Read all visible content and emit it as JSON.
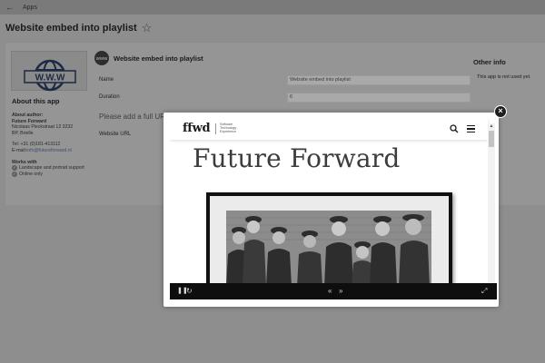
{
  "topbar": {
    "back_icon": "arrow-left-icon",
    "crumb": "Apps"
  },
  "page": {
    "title": "Website embed into playlist",
    "star_icon": "star-outline-icon"
  },
  "logo": {
    "text": "W.W.W",
    "icon": "globe-www-icon"
  },
  "about": {
    "heading": "About this app",
    "author_label": "About author:",
    "author_name": "Future Forward",
    "address_1": "Nicolaas Pieckstraat 12 3232",
    "address_2": "BP, Brielle",
    "tel": "Tel: +31 (0)181-413112",
    "email_label": "E-mail:",
    "email": "info@futureforward.nl",
    "works_with": "Works with",
    "features": [
      "Landscape and portrait support",
      "Online only"
    ]
  },
  "app": {
    "title": "Website embed into playlist",
    "icon_text": "WWW",
    "name_label": "Name",
    "name_value": "Website embed into playlist",
    "duration_label": "Duration",
    "duration_value": "6",
    "full_url_text": "Please add a full UR",
    "website_url_label": "Website URL"
  },
  "other": {
    "title": "Other info",
    "text": "This app is not used yet."
  },
  "modal": {
    "close_icon": "close-icon"
  },
  "site": {
    "logo": "ffwd",
    "tagline_1": "Software",
    "tagline_2": "Technology",
    "tagline_3": "Experience",
    "search_icon": "search-icon",
    "menu_icon": "hamburger-menu-icon",
    "hero_title": "Future Forward",
    "photo_caption": "black-and-white-photo-group-of-boys-in-caps"
  },
  "player": {
    "pause_icon": "pause-icon",
    "refresh_icon": "refresh-icon",
    "prev_icon": "double-chevron-left-icon",
    "next_icon": "double-chevron-right-icon",
    "fullscreen_icon": "fullscreen-icon"
  },
  "colors": {
    "overlay": "#8e8e8e",
    "modal": "#ffffff",
    "player_bar": "#0e0e0e"
  }
}
